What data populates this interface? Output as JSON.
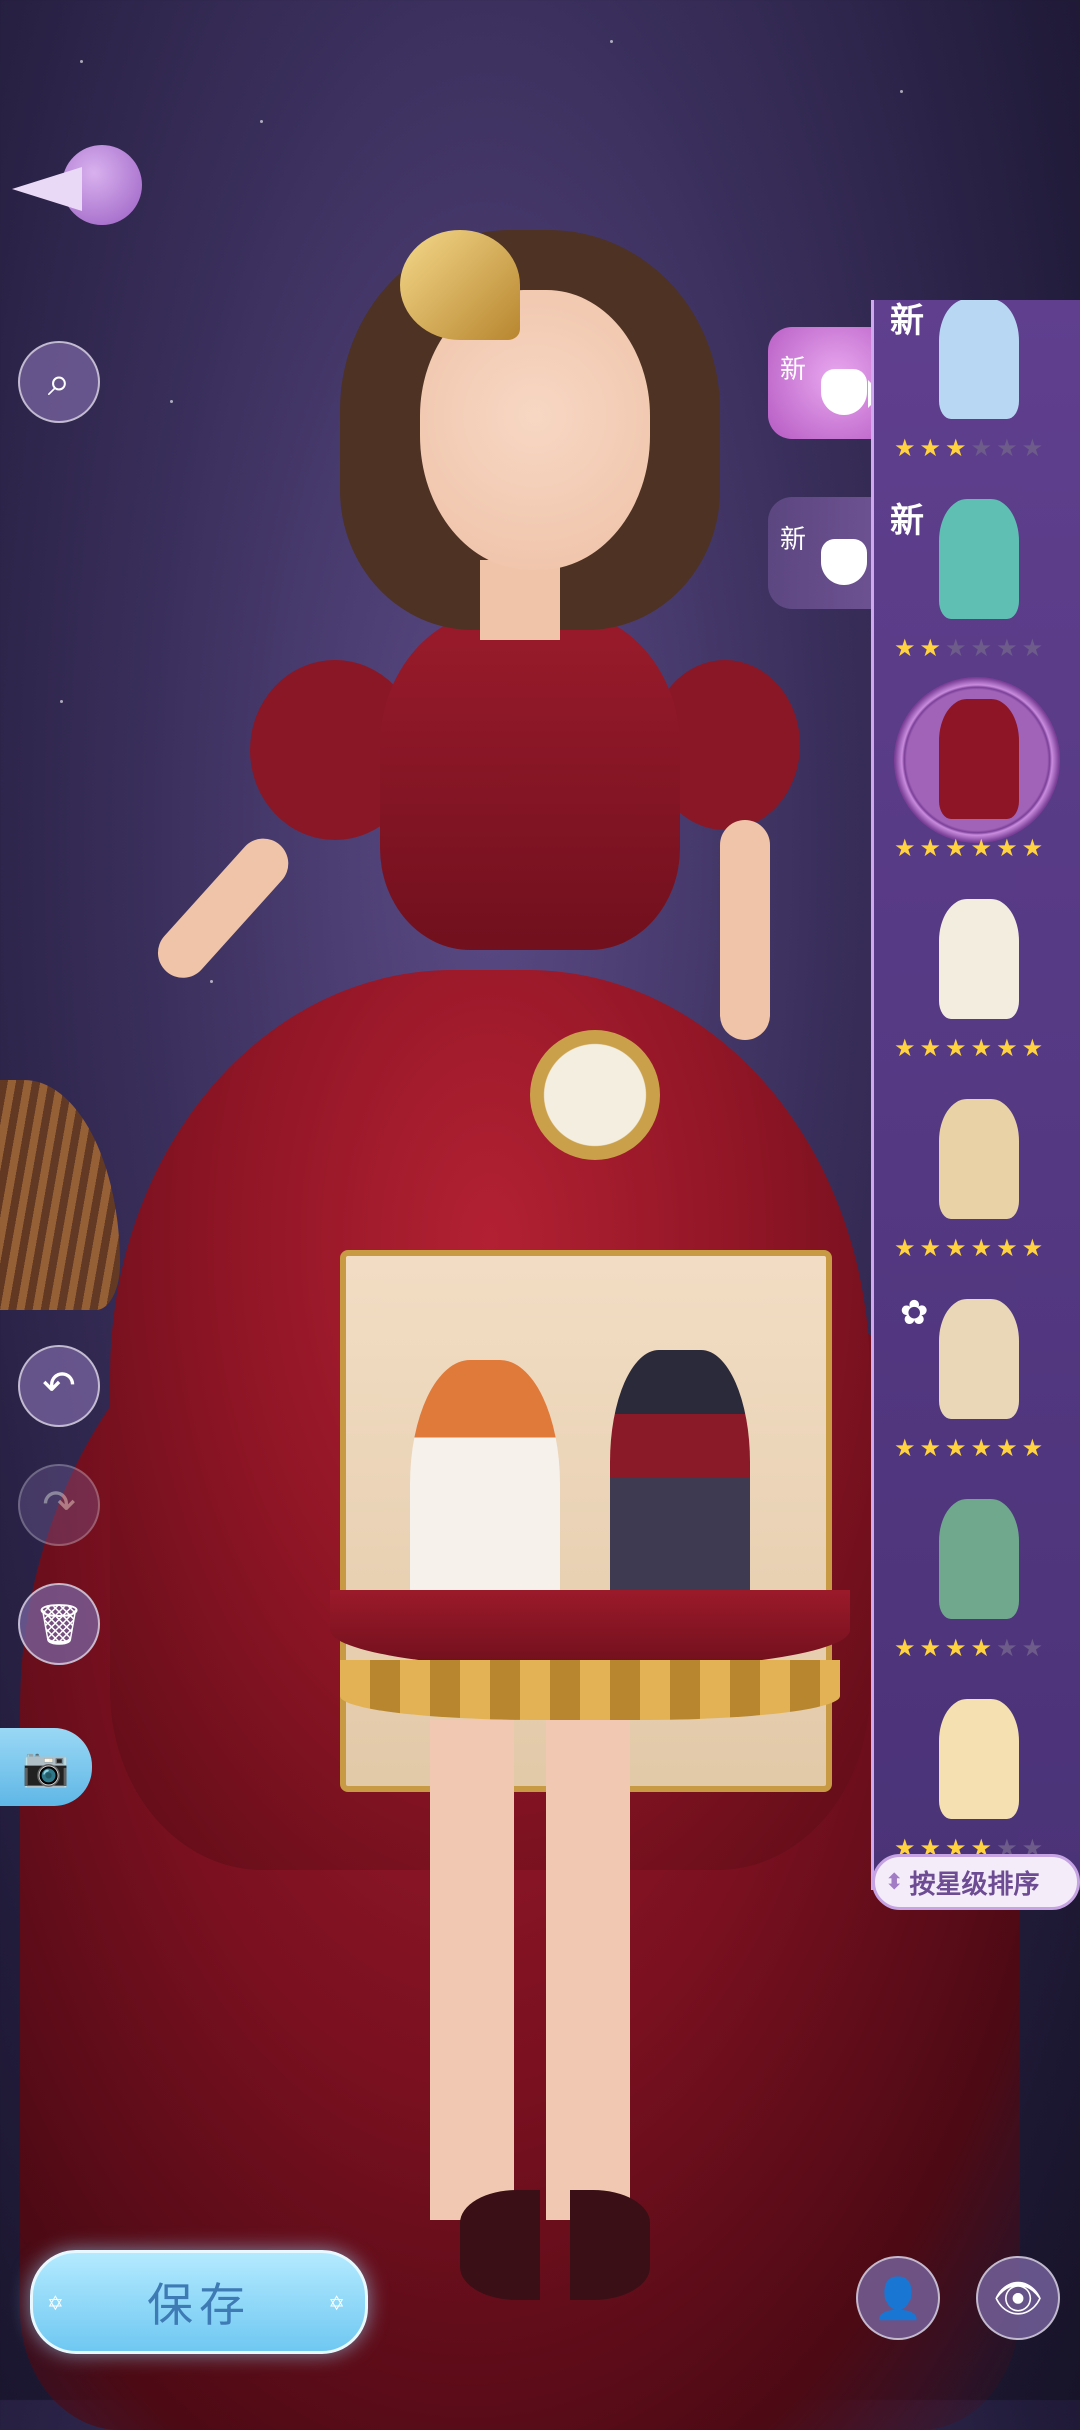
{
  "controls": {
    "back": "back-icon",
    "search": "search-icon",
    "undo": "undo-icon",
    "redo": "redo-icon",
    "delete": "trash-icon",
    "camera": "camera-icon"
  },
  "categories": [
    {
      "label": "新",
      "icon": "dress-icon",
      "active": true
    },
    {
      "label": "新",
      "icon": "top-icon",
      "active": false
    }
  ],
  "wardrobe": {
    "items": [
      {
        "badge": "新",
        "stars": 3,
        "max_stars": 6,
        "color": "#b8d7f2",
        "selected": false
      },
      {
        "badge": "新",
        "stars": 2,
        "max_stars": 6,
        "color": "#5fbfb3",
        "selected": false
      },
      {
        "badge": "",
        "stars": 6,
        "max_stars": 6,
        "color": "#8e1525",
        "selected": true
      },
      {
        "badge": "",
        "stars": 6,
        "max_stars": 6,
        "color": "#f3ede0",
        "selected": false
      },
      {
        "badge": "",
        "stars": 6,
        "max_stars": 6,
        "color": "#e8d2a6",
        "selected": false
      },
      {
        "badge": "flower",
        "stars": 6,
        "max_stars": 6,
        "color": "#e9d7b8",
        "selected": false
      },
      {
        "badge": "",
        "stars": 4,
        "max_stars": 6,
        "color": "#6fa88c",
        "selected": false
      },
      {
        "badge": "",
        "stars": 4,
        "max_stars": 6,
        "color": "#f4e0b0",
        "selected": false
      }
    ]
  },
  "sort_button": {
    "label": "按星级排序",
    "icon": "sort-icon"
  },
  "save_button": {
    "label": "保存"
  },
  "bottom_controls": {
    "pose": "person-icon",
    "view": "eye-icon"
  }
}
